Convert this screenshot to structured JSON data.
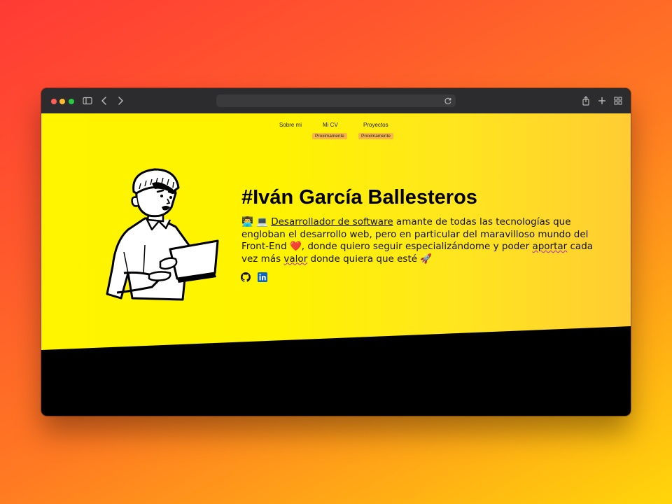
{
  "nav": {
    "items": [
      {
        "label": "Sobre mi",
        "badge": ""
      },
      {
        "label": "Mi CV",
        "badge": "Proximamente"
      },
      {
        "label": "Proyectos",
        "badge": "Proximamente"
      }
    ]
  },
  "hero": {
    "title": "#Iván García Ballesteros",
    "bio_emoji_1": "👨‍💻",
    "bio_emoji_2": "💻",
    "bio_part_1": "Desarrollador de software",
    "bio_part_2": " amante de todas las tecnologías que engloban el desarrollo web, pero en particular del maravilloso mundo del Front-End ",
    "bio_emoji_3": "❤️",
    "bio_part_3": ", donde quiero seguir especializándome y poder ",
    "bio_part_4": "aportar",
    "bio_part_5": " cada vez más ",
    "bio_part_6": "valor",
    "bio_part_7": " donde quiera que esté ",
    "bio_emoji_4": "🚀"
  },
  "social": [
    {
      "icon": "github-icon"
    },
    {
      "icon": "linkedin-icon"
    }
  ],
  "colors": {
    "page_yellow": "#fff500",
    "badge": "#f7b54a",
    "linkedin": "#0a66c2"
  }
}
